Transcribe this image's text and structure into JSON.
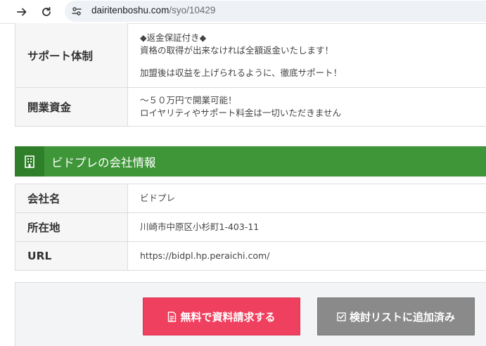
{
  "browser": {
    "url_domain": "dairitenboshu.com",
    "url_path": "/syo/10429"
  },
  "details": {
    "support": {
      "label": "サポート体制",
      "line1": "◆返金保証付き◆",
      "line2": "資格の取得が出来なければ全額返金いたします！",
      "line3": "加盟後は収益を上げられるように、徹底サポート！"
    },
    "fund": {
      "label": "開業資金",
      "line1": "～５０万円で開業可能！",
      "line2": "ロイヤリティやサポート料金は一切いただきません"
    }
  },
  "company_section": {
    "title": "ビドプレの会社情報",
    "icon": "building-icon"
  },
  "company": {
    "name_label": "会社名",
    "name_value": "ビドプレ",
    "address_label": "所在地",
    "address_value": "川崎市中原区小杉町1-403-11",
    "url_label": "URL",
    "url_value": "https://bidpl.hp.peraichi.com/"
  },
  "cta": {
    "request_label": "無料で資料請求する",
    "list_label": "検討リストに追加済み"
  },
  "colors": {
    "section_green": "#3f9638",
    "request_red": "#f0405f",
    "list_gray": "#8a8a8a"
  }
}
